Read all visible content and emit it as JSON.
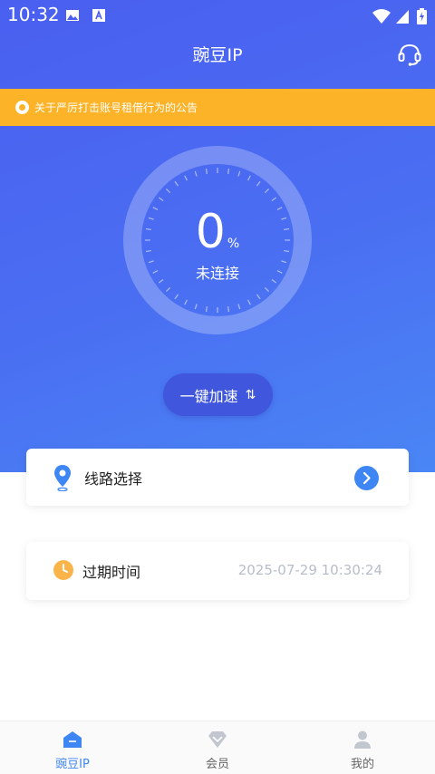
{
  "status_bar": {
    "time": "10:32"
  },
  "header": {
    "title": "豌豆IP"
  },
  "notice": {
    "text": "关于严厉打击账号租借行为的公告"
  },
  "gauge": {
    "value": "0",
    "unit": "%",
    "status": "未连接"
  },
  "accelerate": {
    "label": "一键加速",
    "swap_glyph": "⇅"
  },
  "route": {
    "label": "线路选择"
  },
  "expiry": {
    "label": "过期时间",
    "value": "2025-07-29 10:30:24"
  },
  "tabs": [
    {
      "label": "豌豆IP",
      "active": true
    },
    {
      "label": "会员",
      "active": false
    },
    {
      "label": "我的",
      "active": false
    }
  ],
  "colors": {
    "primary": "#4a6ef2",
    "notice_bg": "#fdb327",
    "accent_blue": "#3e86f3",
    "clock_orange": "#fbb44a"
  }
}
